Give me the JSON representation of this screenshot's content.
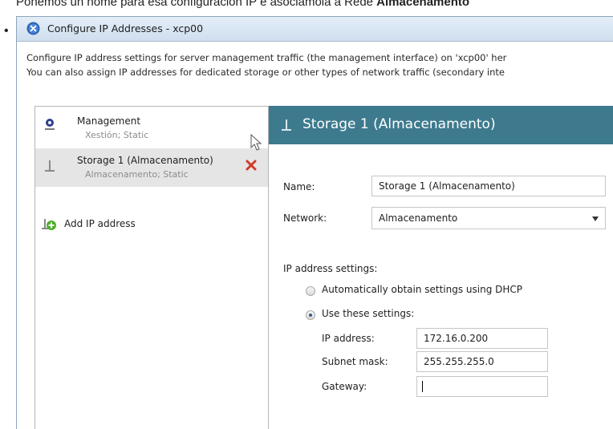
{
  "caption": {
    "prefix": "Poñemos un nome para esa configuración IP e asociámola á Rede ",
    "bold": "Almacenamento"
  },
  "dialog": {
    "title": "Configure IP Addresses - xcp00",
    "description_line1": "Configure IP address settings for server management traffic (the management interface) on 'xcp00' her",
    "description_line2": "You can also assign IP addresses for dedicated storage or other types of network traffic (secondary inte"
  },
  "interfaces": [
    {
      "name": "Management",
      "detail": "Xestión; Static",
      "icon": "management-interface-icon"
    },
    {
      "name": "Storage 1 (Almacenamento)",
      "detail": "Almacenamento; Static",
      "icon": "secondary-interface-icon",
      "selected": true
    }
  ],
  "add_ip_label": "Add IP address",
  "detail_panel": {
    "header": "Storage 1 (Almacenamento)",
    "name_label": "Name:",
    "name_value": "Storage 1 (Almacenamento)",
    "network_label": "Network:",
    "network_value": "Almacenamento",
    "ip_settings_label": "IP address settings:",
    "dhcp_option": "Automatically obtain settings using DHCP",
    "static_option": "Use these settings:",
    "ip_label": "IP address:",
    "ip_value": "172.16.0.200",
    "mask_label": "Subnet mask:",
    "mask_value": "255.255.255.0",
    "gateway_label": "Gateway:",
    "gateway_value": ""
  },
  "colors": {
    "header_band": "#3d7a8e",
    "selected_row": "#e5e5e5",
    "delete_icon": "#d33a2c",
    "add_icon": "#4caf2a"
  }
}
